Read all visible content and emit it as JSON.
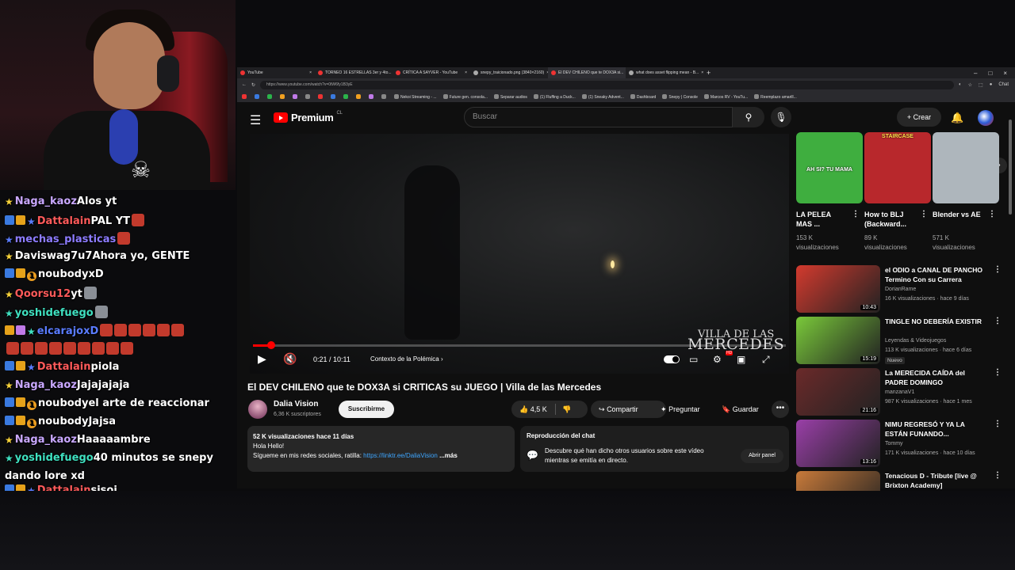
{
  "chat": [
    {
      "badges": [
        "star"
      ],
      "name": "Naga_kaoz",
      "name_color": "#c9a8ff",
      "text": "Alos yt",
      "emotes": 0
    },
    {
      "badges": [
        "blue",
        "gold",
        "bstar"
      ],
      "name": "Dattalain",
      "name_color": "#ff5a5a",
      "text": "PAL YT",
      "emotes": 1
    },
    {
      "badges": [
        "bstar"
      ],
      "name": "mechas_plasticas",
      "name_color": "#8d7cff",
      "text": "",
      "emotes": 1
    },
    {
      "badges": [
        "star"
      ],
      "name": "Daviswag7u7",
      "name_color": "#ffffff",
      "text": "Ahora yo, GENTE",
      "emotes": 0
    },
    {
      "badges": [
        "blue",
        "gold",
        "one"
      ],
      "name": "noubody",
      "name_color": "#ffffff",
      "text": "xD",
      "emotes": 0
    },
    {
      "badges": [
        "star"
      ],
      "name": "Qoorsu12",
      "name_color": "#ff5a5a",
      "text": "yt",
      "emotes": 1
    },
    {
      "badges": [
        "gstar"
      ],
      "name": "yoshidefuego",
      "name_color": "#3fe0c0",
      "text": "",
      "emotes": 1
    },
    {
      "badges": [
        "gold",
        "gift",
        "gstar"
      ],
      "name": "elcarajoxD",
      "name_color": "#5a7cff",
      "text": "",
      "emotes": 6
    },
    {
      "badges": [],
      "name": "",
      "name_color": "#ffffff",
      "text": "",
      "emotes": 9
    },
    {
      "badges": [
        "blue",
        "gold",
        "bstar"
      ],
      "name": "Dattalain",
      "name_color": "#ff5a5a",
      "text": "piola",
      "emotes": 0
    },
    {
      "badges": [
        "star"
      ],
      "name": "Naga_kaoz",
      "name_color": "#c9a8ff",
      "text": "Jajajajaja",
      "emotes": 0
    },
    {
      "badges": [
        "blue",
        "gold",
        "one"
      ],
      "name": "noubody",
      "name_color": "#ffffff",
      "text": "el arte de reaccionar",
      "emotes": 0
    },
    {
      "badges": [
        "blue",
        "gold",
        "one"
      ],
      "name": "noubody",
      "name_color": "#ffffff",
      "text": "Jajsa",
      "emotes": 0
    },
    {
      "badges": [
        "star"
      ],
      "name": "Naga_kaoz",
      "name_color": "#c9a8ff",
      "text": "Haaaaambre",
      "emotes": 0
    },
    {
      "badges": [
        "gstar"
      ],
      "name": "yoshidefuego",
      "name_color": "#3fe0c0",
      "text": "40 minutos se snepy",
      "emotes": 0
    },
    {
      "badges": [],
      "name": "",
      "name_color": "#ffffff",
      "text": "dando lore xd",
      "emotes": 0
    },
    {
      "badges": [
        "blue",
        "gold",
        "bstar"
      ],
      "name": "Dattalain",
      "name_color": "#ff5a5a",
      "text": "sisoi",
      "emotes": 0
    }
  ],
  "browser": {
    "tabs": [
      "YouTube",
      "TORNEO 16 ESTRELLAS 3er y 4to...",
      "CRÍTICA A SAYVER - YouTube",
      "snepy_traicionado.png (3840×2160)",
      "El DEV CHILENO que te DOX3A si...",
      "what does asset flipping mean - B..."
    ],
    "active_tab": 4,
    "url": "https://www.youtube.com/watch?v=0tW6fy1B3yE",
    "bookmarks": [
      "Nekoi Streaming - ...",
      "Future gen. consola...",
      "Separar audios",
      "(1) Fluffing a Duck...",
      "(1) Sneaky Advent...",
      "Dashboard",
      "Snepy | Console",
      "Marcos RV - YouTu...",
      "Reemplazo amarill..."
    ],
    "profile_label": "Chat"
  },
  "youtube": {
    "logo_text": "Premium",
    "logo_country": "CL",
    "search_placeholder": "Buscar",
    "create_label": "Crear",
    "player": {
      "time": "0:21 / 10:11",
      "chapter": "Contexto de la Polémica",
      "progress_fraction": 0.034,
      "watermark_small": "VILLA DE LAS",
      "watermark_big": "MERCEDES",
      "hd_badge": "HD"
    },
    "video_title": "El DEV CHILENO que te DOX3A si CRITICAS su JUEGO | Villa de las Mercedes",
    "channel": {
      "name": "Dalia Vision",
      "subs": "6,36 K suscriptores",
      "subscribe": "Suscribirme"
    },
    "actions": {
      "likes": "4,5 K",
      "share": "Compartir",
      "ask": "Preguntar",
      "save": "Guardar"
    },
    "description": {
      "stats": "52 K visualizaciones  hace 11 días",
      "line1": "Hola Hello!",
      "line2": "Sígueme en mis redes sociales, ratilla: ",
      "link": "https://linktr.ee/DaliaVision",
      "more": "...más"
    },
    "chat_replay": {
      "title": "Reproducción del chat",
      "text": "Descubre qué han dicho otros usuarios sobre este vídeo mientras se emitía en directo.",
      "button": "Abrir panel"
    },
    "shelf": [
      {
        "title": "LA PELEA MAS ...",
        "views": "153 K visualizaciones",
        "overlay": "AH SI? TU MAMA",
        "bg": "#3fae3f"
      },
      {
        "title": "How to BLJ (Backward...",
        "views": "89 K visualizaciones",
        "overlay": "STAIRCASE",
        "bg": "#b8282c"
      },
      {
        "title": "Blender vs AE",
        "views": "571 K visualizaciones",
        "overlay": "",
        "bg": "#aeb6bc"
      }
    ],
    "recommended": [
      {
        "title": "el ODIO a CANAL DE PANCHO Termino Con su Carrera",
        "channel": "DorianRame",
        "meta": "16 K visualizaciones · hace 9 días",
        "duration": "10:43",
        "badge": "",
        "thumb": "#d33a2e"
      },
      {
        "title": "TINGLE NO DEBERÍA EXISTIR",
        "channel": "Leyendas & Videojuegos",
        "meta": "113 K visualizaciones · hace 6 días",
        "duration": "15:19",
        "badge": "Nuevo",
        "thumb": "#7ac93a"
      },
      {
        "title": "La MERECIDA CAÍDA del PADRE DOMINGO",
        "channel": "manzanaV1",
        "meta": "987 K visualizaciones · hace 1 mes",
        "duration": "21:16",
        "badge": "",
        "thumb": "#6b2a2a"
      },
      {
        "title": "NIMU REGRESÓ Y YA LA ESTÁN FUNANDO...",
        "channel": "Tommy",
        "meta": "171 K visualizaciones · hace 10 días",
        "duration": "13:16",
        "badge": "",
        "thumb": "#9a3fa8"
      },
      {
        "title": "Tenacious D - Tribute [live @ Brixton Academy]",
        "channel": "",
        "meta": "",
        "duration": "",
        "badge": "",
        "thumb": "#c87a3a"
      }
    ]
  }
}
